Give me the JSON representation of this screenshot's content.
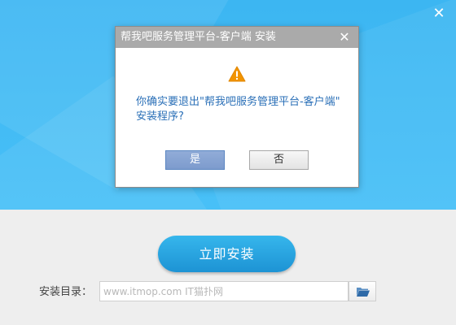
{
  "installer": {
    "close_glyph": "✕",
    "install_button_label": "立即安装",
    "dir_label": "安装目录：",
    "dir_input_value": "",
    "dir_input_placeholder": "www.itmop.com IT猫扑网",
    "browse_icon": "folder-open-icon"
  },
  "dialog": {
    "title": "帮我吧服务管理平台-客户端 安装",
    "close_glyph": "✕",
    "icon": "warning-icon",
    "message_line1": "你确实要退出\"帮我吧服务管理平台-客户端\"",
    "message_line2": "安装程序?",
    "yes_label": "是",
    "no_label": "否"
  },
  "colors": {
    "hero_blue": "#48c0f7",
    "install_button": "#1d93d4",
    "dialog_titlebar": "#aaaaaa",
    "message_text": "#2a6fb7",
    "warning_orange": "#f29400"
  }
}
